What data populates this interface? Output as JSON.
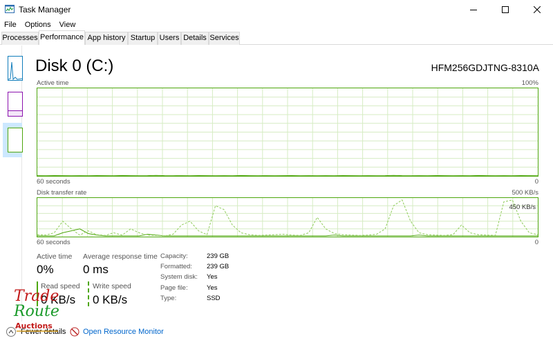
{
  "window": {
    "title": "Task Manager",
    "controls": [
      "minimize",
      "maximize",
      "close"
    ]
  },
  "menu": [
    "File",
    "Options",
    "View"
  ],
  "tabs": [
    {
      "label": "Processes",
      "active": false
    },
    {
      "label": "Performance",
      "active": true
    },
    {
      "label": "App history",
      "active": false
    },
    {
      "label": "Startup",
      "active": false
    },
    {
      "label": "Users",
      "active": false
    },
    {
      "label": "Details",
      "active": false
    },
    {
      "label": "Services",
      "active": false
    }
  ],
  "sidebar": {
    "items": [
      {
        "name": "cpu",
        "color": "#117dbb"
      },
      {
        "name": "memory",
        "color": "#8b12ae"
      },
      {
        "name": "disk",
        "color": "#4da60c",
        "selected": true
      }
    ]
  },
  "header": {
    "title": "Disk 0 (C:)",
    "model": "HFM256GDJTNG-8310A"
  },
  "active_graph": {
    "label": "Active time",
    "max_label": "100%",
    "time_label": "60 seconds",
    "min_label": "0",
    "color": "#4da60c",
    "values": [
      0.3,
      0.2,
      0.4,
      0.3,
      0.2,
      0.3,
      0.2,
      0.4,
      0.3,
      0.2,
      0.5,
      0.3,
      0.2,
      0.3,
      0.6,
      0.3,
      0.2,
      0.3,
      0.2,
      0.4,
      0.3,
      0.2,
      0.3,
      0.2,
      0.5,
      0.3,
      0.2,
      0.3,
      0.2,
      0.3,
      0.4,
      0.2,
      0.3,
      0.2,
      0.3,
      0.2,
      0.4,
      0.3,
      0.2,
      0.3,
      0.2,
      0.3,
      0.6,
      0.3,
      0.2,
      0.3,
      0.2,
      0.4,
      0.3,
      0.2,
      0.3,
      0.2,
      0.5,
      0.3,
      0.2,
      0.3,
      0.2,
      0.4,
      0.3,
      0.2
    ]
  },
  "transfer_graph": {
    "label": "Disk transfer rate",
    "max_label": "500 KB/s",
    "secondary_label": "450 KB/s",
    "time_label": "60 seconds",
    "min_label": "0",
    "color": "#4da60c",
    "read_values": [
      2,
      2,
      2,
      10,
      15,
      20,
      8,
      4,
      2,
      2,
      2,
      2,
      2,
      6,
      4,
      2,
      2,
      2,
      2,
      2,
      2,
      2,
      2,
      2,
      2,
      2,
      2,
      2,
      2,
      2,
      2,
      2,
      2,
      2,
      2,
      4,
      2,
      2,
      2,
      2,
      2,
      2,
      2,
      2,
      2,
      4,
      2,
      2,
      2,
      2,
      2,
      2,
      2,
      2,
      2,
      2,
      2,
      2,
      2,
      2
    ],
    "write_values": [
      5,
      4,
      10,
      40,
      20,
      4,
      15,
      5,
      3,
      10,
      4,
      20,
      10,
      4,
      3,
      2,
      6,
      30,
      40,
      15,
      5,
      80,
      70,
      30,
      10,
      5,
      3,
      4,
      5,
      6,
      4,
      3,
      10,
      50,
      20,
      8,
      5,
      4,
      3,
      4,
      6,
      20,
      80,
      95,
      40,
      10,
      5,
      4,
      3,
      5,
      30,
      10,
      5,
      4,
      3,
      90,
      95,
      40,
      10,
      5
    ]
  },
  "stats": {
    "active_time": {
      "label": "Active time",
      "value": "0%"
    },
    "avg_response": {
      "label": "Average response time",
      "value": "0 ms"
    },
    "read_speed": {
      "label": "Read speed",
      "value": "0 KB/s"
    },
    "write_speed": {
      "label": "Write speed",
      "value": "0 KB/s"
    }
  },
  "properties": [
    {
      "key": "Capacity:",
      "value": "239 GB"
    },
    {
      "key": "Formatted:",
      "value": "239 GB"
    },
    {
      "key": "System disk:",
      "value": "Yes"
    },
    {
      "key": "Page file:",
      "value": "Yes"
    },
    {
      "key": "Type:",
      "value": "SSD"
    }
  ],
  "footer": {
    "fewer_details": "Fewer details",
    "resource_monitor": "Open Resource Monitor"
  },
  "watermark": {
    "line1": "Trade",
    "line2": "Route",
    "line3": "Auctions"
  }
}
